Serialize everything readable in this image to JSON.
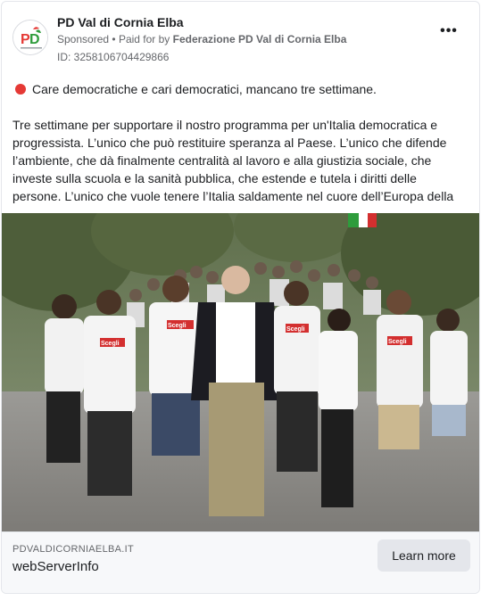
{
  "ad": {
    "page_name": "PD Val di Cornia Elba",
    "sponsored_label": "Sponsored",
    "paid_for_prefix": "Paid for by",
    "paid_for_by": "Federazione PD Val di Cornia Elba",
    "ad_id": "ID: 3258106704429866",
    "more_icon": "more-horizontal-icon"
  },
  "body": {
    "intro": "Care democratiche e cari democratici, mancano tre settimane.",
    "paragraph": "Tre settimane per supportare il nostro programma per un'Italia democratica e progressista. L’unico che può restituire speranza al Paese. L’unico che difende l’ambiente, che dà finalmente centralità al lavoro e alla giustizia sociale, che investe sulla scuola e la sanità pubblica, che estende e tutela i diritti delle persone. L’unico che vuole tenere l’Italia saldamente nel cuore dell’Europa della solidarietà,..."
  },
  "media": {
    "shirt_label": "Scegli"
  },
  "link": {
    "domain": "PDVALDICORNIAELBA.IT",
    "title": "webServerInfo",
    "cta_label": "Learn more"
  },
  "colors": {
    "accent_red": "#e53935",
    "text_primary": "#1c1e21",
    "text_secondary": "#65676b",
    "button_bg": "#e4e6eb"
  }
}
